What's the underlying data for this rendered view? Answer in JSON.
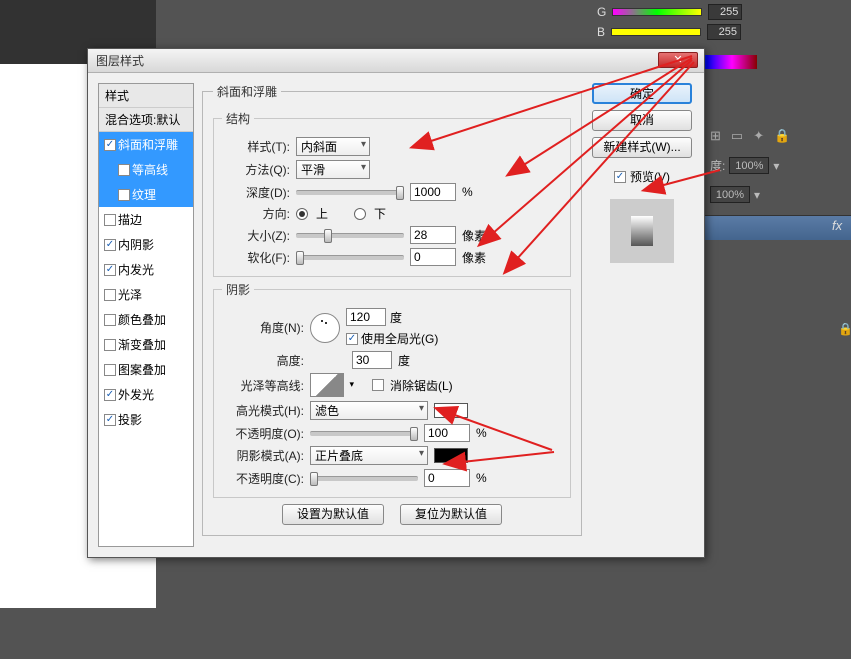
{
  "background": {
    "color_panel": {
      "g_label": "G",
      "g_value": "255",
      "b_label": "B",
      "b_value": "255"
    },
    "opacity1": "100%",
    "opacity2": "100%",
    "fx_label": "fx"
  },
  "dialog": {
    "title": "图层样式",
    "ok": "确定",
    "cancel": "取消",
    "newstyle": "新建样式(W)...",
    "preview": "预览(V)",
    "set_default": "设置为默认值",
    "reset_default": "复位为默认值"
  },
  "styles": {
    "header": "样式",
    "blend_defaults": "混合选项:默认",
    "bevel": "斜面和浮雕",
    "contour": "等高线",
    "texture": "纹理",
    "stroke": "描边",
    "inner_shadow": "内阴影",
    "inner_glow": "内发光",
    "satin": "光泽",
    "color_overlay": "颜色叠加",
    "gradient_overlay": "渐变叠加",
    "pattern_overlay": "图案叠加",
    "outer_glow": "外发光",
    "drop_shadow": "投影"
  },
  "bevel": {
    "section": "斜面和浮雕",
    "structure": "结构",
    "style_label": "样式(T):",
    "style_value": "内斜面",
    "technique_label": "方法(Q):",
    "technique_value": "平滑",
    "depth_label": "深度(D):",
    "depth_value": "1000",
    "depth_unit": "%",
    "direction_label": "方向:",
    "up": "上",
    "down": "下",
    "size_label": "大小(Z):",
    "size_value": "28",
    "size_unit": "像素",
    "soften_label": "软化(F):",
    "soften_value": "0",
    "soften_unit": "像素"
  },
  "shading": {
    "section": "阴影",
    "angle_label": "角度(N):",
    "angle_value": "120",
    "angle_unit": "度",
    "global_light": "使用全局光(G)",
    "altitude_label": "高度:",
    "altitude_value": "30",
    "altitude_unit": "度",
    "gloss_contour_label": "光泽等高线:",
    "antialias": "消除锯齿(L)",
    "highlight_mode_label": "高光模式(H):",
    "highlight_mode_value": "滤色",
    "highlight_opacity_label": "不透明度(O):",
    "highlight_opacity_value": "100",
    "highlight_opacity_unit": "%",
    "shadow_mode_label": "阴影模式(A):",
    "shadow_mode_value": "正片叠底",
    "shadow_opacity_label": "不透明度(C):",
    "shadow_opacity_value": "0",
    "shadow_opacity_unit": "%",
    "highlight_color": "#ffffff",
    "shadow_color": "#000000"
  }
}
